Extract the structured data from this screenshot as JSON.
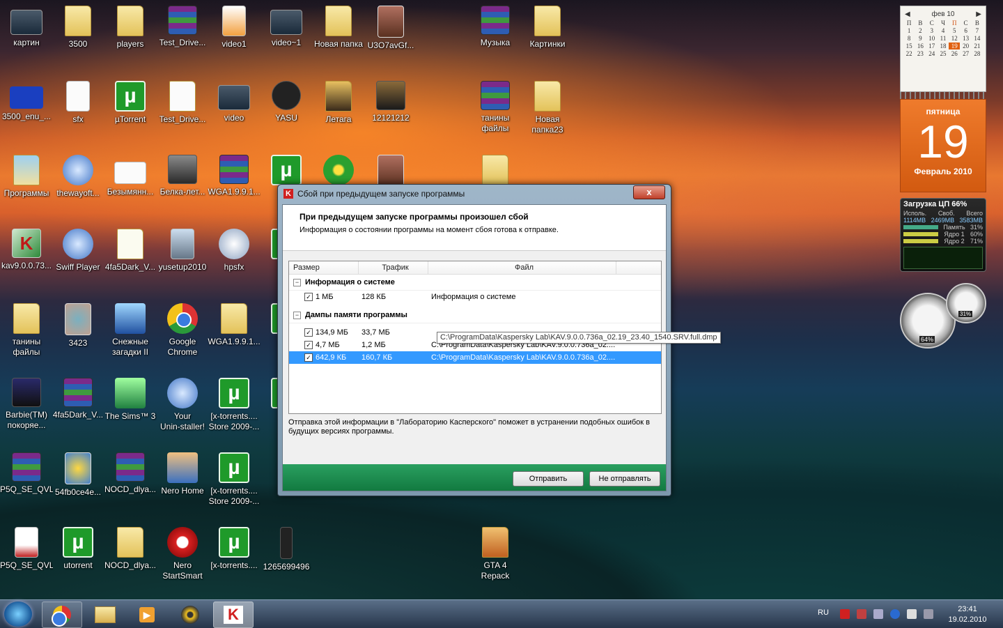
{
  "desktop": {
    "icons": [
      {
        "label": "картин",
        "label2": ""
      },
      {
        "label": "3500",
        "label2": ""
      },
      {
        "label": "players",
        "label2": ""
      },
      {
        "label": "Test_Drive...",
        "label2": ""
      },
      {
        "label": "video1",
        "label2": ""
      },
      {
        "label": "video~1",
        "label2": ""
      },
      {
        "label": "Новая папка",
        "label2": ""
      },
      {
        "label": "U3O7avGf...",
        "label2": ""
      },
      {
        "label": "Музыка",
        "label2": ""
      },
      {
        "label": "Картинки",
        "label2": ""
      },
      {
        "label": "3500_enu_...",
        "label2": ""
      },
      {
        "label": "sfx",
        "label2": ""
      },
      {
        "label": "µTorrent",
        "label2": ""
      },
      {
        "label": "Test_Drive...",
        "label2": ""
      },
      {
        "label": "video",
        "label2": ""
      },
      {
        "label": "YASU",
        "label2": ""
      },
      {
        "label": "Летага",
        "label2": ""
      },
      {
        "label": "12121212",
        "label2": ""
      },
      {
        "label": "танины",
        "label2": "файлы"
      },
      {
        "label": "Новая",
        "label2": "папка23"
      },
      {
        "label": "Программы",
        "label2": ""
      },
      {
        "label": "thewayoft...",
        "label2": ""
      },
      {
        "label": "Безымянн...",
        "label2": ""
      },
      {
        "label": "Белка-лет...",
        "label2": ""
      },
      {
        "label": "WGA1.9.9.1...",
        "label2": ""
      },
      {
        "label": "Th",
        "label2": "pat"
      },
      {
        "label": "kav9.0.0.73...",
        "label2": ""
      },
      {
        "label": "Swiff Player",
        "label2": ""
      },
      {
        "label": "4fa5Dark_V...",
        "label2": ""
      },
      {
        "label": "yusetup2010",
        "label2": ""
      },
      {
        "label": "hpsfx",
        "label2": ""
      },
      {
        "label": "[x-t",
        "label2": "Sim"
      },
      {
        "label": "танины",
        "label2": "файлы"
      },
      {
        "label": "3423",
        "label2": ""
      },
      {
        "label": "Снежные",
        "label2": "загадки II"
      },
      {
        "label": "Google",
        "label2": "Chrome"
      },
      {
        "label": "WGA1.9.9.1...",
        "label2": ""
      },
      {
        "label": "x_7",
        "label2": ""
      },
      {
        "label": "Barbie(TM)",
        "label2": "покоряе..."
      },
      {
        "label": "4fa5Dark_V...",
        "label2": ""
      },
      {
        "label": "The Sims™ 3",
        "label2": ""
      },
      {
        "label": "Your",
        "label2": "Unin-staller!"
      },
      {
        "label": "[x-torrents....",
        "label2": "Store 2009-..."
      },
      {
        "label": "[x-t",
        "label2": ""
      },
      {
        "label": "P5Q_SE_QVL",
        "label2": ""
      },
      {
        "label": "54fb0ce4e...",
        "label2": ""
      },
      {
        "label": "NOCD_dlya...",
        "label2": ""
      },
      {
        "label": "Nero Home",
        "label2": ""
      },
      {
        "label": "[x-torrents....",
        "label2": "Store 2009-..."
      },
      {
        "label": "686",
        "label2": ""
      },
      {
        "label": "P5Q_SE_QVL",
        "label2": ""
      },
      {
        "label": "utorrent",
        "label2": ""
      },
      {
        "label": "NOCD_dlya...",
        "label2": ""
      },
      {
        "label": "Nero",
        "label2": "StartSmart"
      },
      {
        "label": "[x-torrents....",
        "label2": ""
      },
      {
        "label": "1265699496",
        "label2": ""
      },
      {
        "label": "GTA 4",
        "label2": "Repack"
      }
    ]
  },
  "calendar": {
    "month_short": "фев 10",
    "weekdays": [
      "П",
      "В",
      "С",
      "Ч",
      "П",
      "С",
      "В"
    ],
    "days": [
      "1",
      "2",
      "3",
      "4",
      "5",
      "6",
      "7",
      "8",
      "9",
      "10",
      "11",
      "12",
      "13",
      "14",
      "15",
      "16",
      "17",
      "18",
      "19",
      "20",
      "21",
      "22",
      "23",
      "24",
      "25",
      "26",
      "27",
      "28"
    ],
    "today": "19",
    "weekday_full": "пятница",
    "day_big": "19",
    "month_year": "Февраль 2010"
  },
  "cpu_meter": {
    "title": "Загрузка ЦП",
    "percent": "66%",
    "h1": "Исполь.",
    "h2": "Своб.",
    "h3": "Всего",
    "v1": "1114MB",
    "v2": "2469MB",
    "v3": "3583MB",
    "mem_label": "Память",
    "mem_val": "31%",
    "core1_label": "Ядро 1",
    "core1_val": "60%",
    "core2_label": "Ядро 2",
    "core2_val": "71%"
  },
  "gauges": {
    "cpu": "64%",
    "mem": "31%"
  },
  "dialog": {
    "title": "Сбой при предыдущем запуске программы",
    "heading": "При предыдущем запуске программы произошел сбой",
    "subheading": "Информация о состоянии программы на момент сбоя готова к отправке.",
    "columns": {
      "size": "Размер",
      "traffic": "Трафик",
      "file": "Файл"
    },
    "group1": {
      "label": "Информация о системе",
      "rows": [
        {
          "size": "1 МБ",
          "traffic": "128 КБ",
          "file": "Информация о системе"
        }
      ]
    },
    "group2": {
      "label": "Дампы памяти программы",
      "rows": [
        {
          "size": "134,9 МБ",
          "traffic": "33,7 МБ",
          "file": ""
        },
        {
          "size": "4,7 МБ",
          "traffic": "1,2 МБ",
          "file": "C:\\ProgramData\\Kaspersky Lab\\KAV.9.0.0.736a_02...."
        },
        {
          "size": "642,9 КБ",
          "traffic": "160,7 КБ",
          "file": "C:\\ProgramData\\Kaspersky Lab\\KAV.9.0.0.736a_02...."
        }
      ]
    },
    "tooltip": "C:\\ProgramData\\Kaspersky Lab\\KAV.9.0.0.736a_02.19_23.40_1540.SRV.full.dmp",
    "note": "Отправка этой информации в \"Лабораторию Касперского\" поможет в устранении подобных ошибок в будущих версиях программы.",
    "send": "Отправить",
    "dont_send": "Не отправлять",
    "close": "x"
  },
  "taskbar": {
    "lang": "RU",
    "time": "23:41",
    "date": "19.02.2010"
  }
}
